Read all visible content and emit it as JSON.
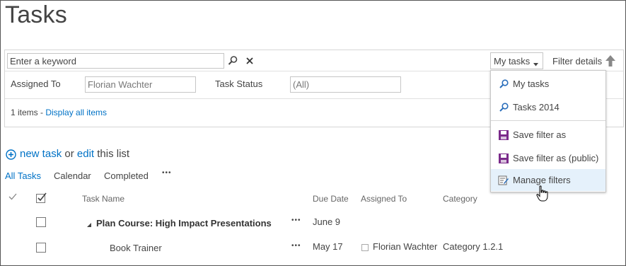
{
  "page": {
    "title": "Tasks"
  },
  "filter": {
    "keyword_placeholder": "Enter a keyword",
    "view_selector": "My tasks",
    "filter_details": "Filter details",
    "assigned_to_label": "Assigned To",
    "assigned_to_value": "Florian Wachter",
    "task_status_label": "Task Status",
    "task_status_value": "(All)",
    "items_count": "1 items - ",
    "display_all": "Display all items"
  },
  "menu": {
    "items": [
      {
        "label": "My tasks",
        "icon": "search-icon"
      },
      {
        "label": "Tasks 2014",
        "icon": "search-icon"
      },
      {
        "label": "Save filter as",
        "icon": "save-icon"
      },
      {
        "label": "Save filter as (public)",
        "icon": "save-icon"
      },
      {
        "label": "Manage filters",
        "icon": "manage-filters-icon"
      }
    ]
  },
  "commands": {
    "new_task": "new task",
    "or": "or",
    "edit": "edit",
    "this_list": "this list"
  },
  "views": {
    "all_tasks": "All Tasks",
    "calendar": "Calendar",
    "completed": "Completed",
    "more": "•••"
  },
  "table": {
    "headers": {
      "task_name": "Task Name",
      "due_date": "Due Date",
      "assigned_to": "Assigned To",
      "category": "Category"
    },
    "rows": [
      {
        "task": "Plan Course: High Impact Presentations",
        "due": "June 9",
        "assigned": "",
        "category": ""
      },
      {
        "task": "Book Trainer",
        "due": "May 17",
        "assigned": "Florian Wachter",
        "category": "Category 1.2.1"
      }
    ],
    "ellipsis": "•••"
  },
  "colors": {
    "link": "#0072c6",
    "menu_highlight": "#e5f1fb",
    "save_icon": "#7a2a8a"
  }
}
